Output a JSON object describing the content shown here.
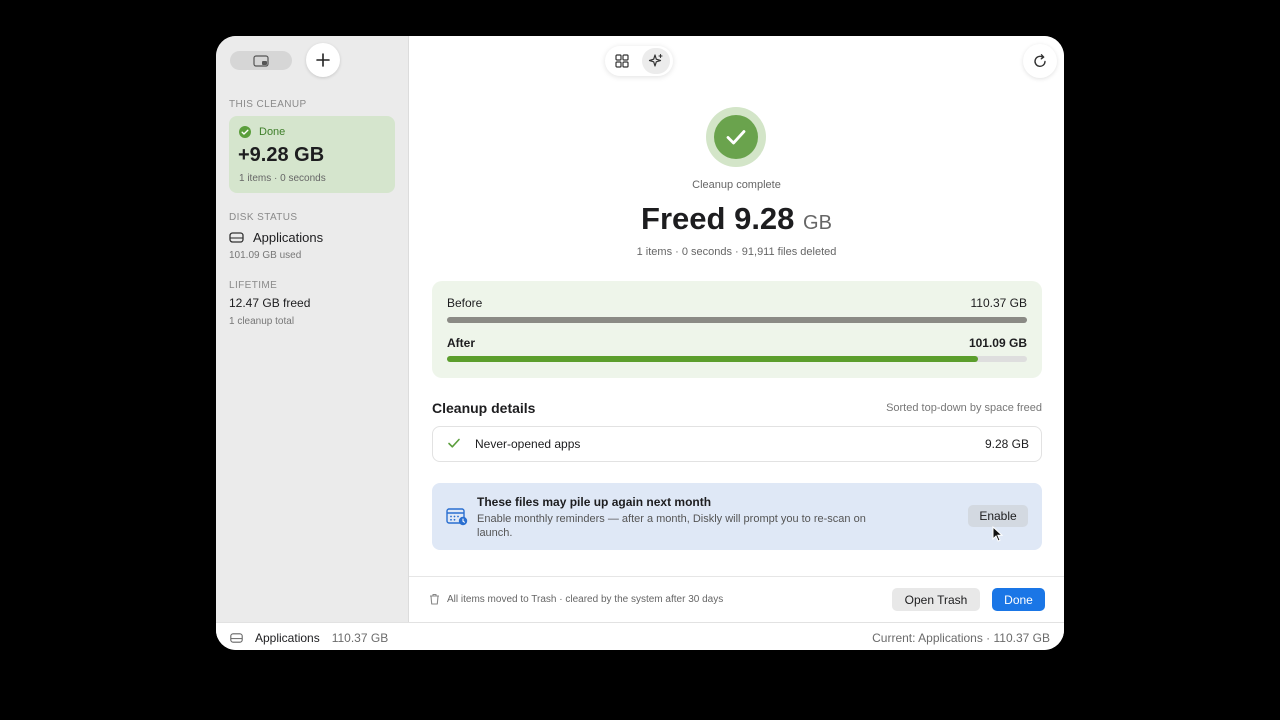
{
  "sidebar": {
    "this_cleanup_title": "THIS CLEANUP",
    "status_label": "Done",
    "freed_amount": "+9.28 GB",
    "summary": "1 items · 0 seconds",
    "disk_status_title": "DISK STATUS",
    "disk_name": "Applications",
    "disk_used": "101.09 GB used",
    "lifetime_title": "LIFETIME",
    "lifetime_freed": "12.47 GB freed",
    "lifetime_total": "1 cleanup total"
  },
  "main": {
    "complete_label": "Cleanup complete",
    "freed_prefix": "Freed",
    "freed_value": "9.28",
    "freed_unit": "GB",
    "summary": "1 items · 0 seconds · 91,911 files deleted",
    "comparison": {
      "before_label": "Before",
      "before_value": "110.37 GB",
      "before_fraction": 1.0,
      "after_label": "After",
      "after_value": "101.09 GB",
      "after_fraction": 0.916
    },
    "details": {
      "title": "Cleanup details",
      "sort_note": "Sorted top-down by space freed",
      "items": [
        {
          "name": "Never-opened apps",
          "size": "9.28 GB"
        }
      ]
    },
    "reminder": {
      "title": "These files may pile up again next month",
      "body": "Enable monthly reminders — after a month, Diskly will prompt you to re-scan on launch.",
      "button": "Enable"
    },
    "footer": {
      "note": "All items moved to Trash · cleared by the system after 30 days",
      "open_trash": "Open Trash",
      "done": "Done"
    }
  },
  "statusbar": {
    "disk_name": "Applications",
    "disk_size": "110.37 GB",
    "current": "Current: Applications · 110.37 GB"
  },
  "colors": {
    "accent_green": "#6aa34d",
    "bar_before": "#8a8a84",
    "bar_after": "#5b9e2c",
    "primary_blue": "#1a76e6"
  },
  "icons": {
    "sidebar_toggle": "sidebar-toggle-icon",
    "add": "plus-icon",
    "grid": "grid-icon",
    "sparkle": "sparkle-icon",
    "refresh": "refresh-icon",
    "check": "checkmark-icon",
    "disk": "disk-icon",
    "calendar": "calendar-icon",
    "trash": "trash-icon"
  }
}
